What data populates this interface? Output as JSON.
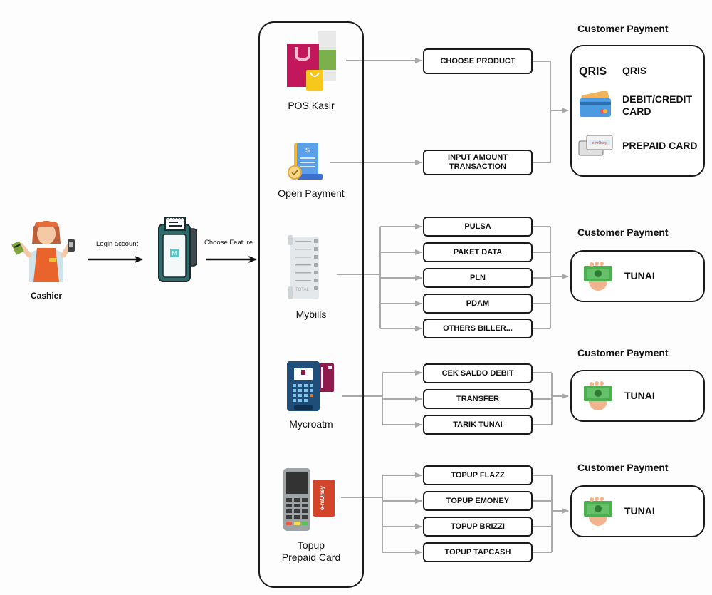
{
  "actors": {
    "cashier_label": "Cashier",
    "login_label": "Login account",
    "choose_feature_label": "Choose Feature"
  },
  "features": [
    {
      "id": "pos-kasir",
      "label": "POS Kasir"
    },
    {
      "id": "open-payment",
      "label": "Open Payment"
    },
    {
      "id": "mybills",
      "label": "Mybills"
    },
    {
      "id": "mycroatm",
      "label": "Mycroatm"
    },
    {
      "id": "topup-prepaid",
      "label": "Topup\nPrepaid Card"
    }
  ],
  "steps": {
    "pos": [
      "CHOOSE PRODUCT"
    ],
    "open_payment": [
      "INPUT AMOUNT\nTRANSACTION"
    ],
    "mybills": [
      "PULSA",
      "PAKET DATA",
      "PLN",
      "PDAM",
      "OTHERS BILLER..."
    ],
    "mycroatm": [
      "CEK SALDO DEBIT",
      "TRANSFER",
      "TARIK TUNAI"
    ],
    "topup": [
      "TOPUP FLAZZ",
      "TOPUP EMONEY",
      "TOPUP BRIZZI",
      "TOPUP TAPCASH"
    ]
  },
  "payments": [
    {
      "title": "Customer Payment",
      "items": [
        {
          "icon": "qris-logo-icon",
          "label": "QRIS"
        },
        {
          "icon": "credit-card-icon",
          "label": "DEBIT/CREDIT\nCARD"
        },
        {
          "icon": "prepaid-card-icon",
          "label": "PREPAID CARD"
        }
      ]
    },
    {
      "title": "Customer Payment",
      "items": [
        {
          "icon": "cash-hand-icon",
          "label": "TUNAI"
        }
      ]
    },
    {
      "title": "Customer Payment",
      "items": [
        {
          "icon": "cash-hand-icon",
          "label": "TUNAI"
        }
      ]
    },
    {
      "title": "Customer Payment",
      "items": [
        {
          "icon": "cash-hand-icon",
          "label": "TUNAI"
        }
      ]
    }
  ],
  "icon_texts": {
    "qris": "QRIS",
    "emoney": "e-mOney",
    "total": "TOTAL"
  },
  "colors": {
    "connector": "#a9a9a9",
    "border": "#1a1a1a",
    "money_green": "#4caf50",
    "device_teal": "#2f6b6b"
  }
}
